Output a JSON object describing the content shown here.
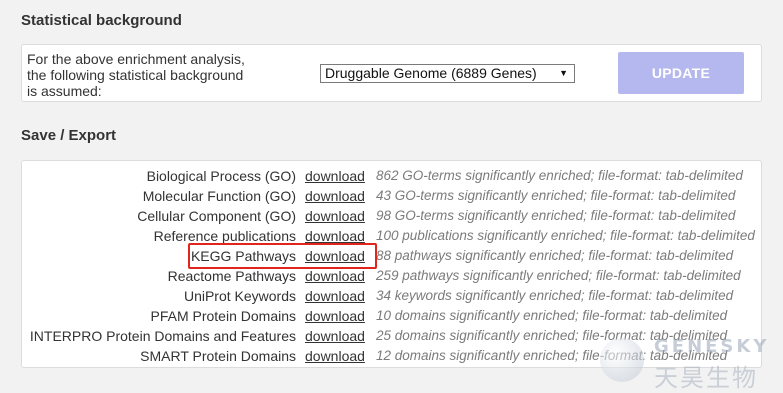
{
  "statistical_background": {
    "title": "Statistical background",
    "description_lines": [
      "For the above enrichment analysis,",
      "the following statistical background",
      "is assumed:"
    ],
    "select": {
      "selected": "Druggable Genome (6889 Genes)"
    },
    "update_label": "UPDATE"
  },
  "save_export": {
    "title": "Save / Export",
    "rows": [
      {
        "label": "Biological Process (GO)",
        "link": "download",
        "description": "862 GO-terms significantly enriched; file-format: tab-delimited"
      },
      {
        "label": "Molecular Function (GO)",
        "link": "download",
        "description": "43 GO-terms significantly enriched; file-format: tab-delimited"
      },
      {
        "label": "Cellular Component (GO)",
        "link": "download",
        "description": "98 GO-terms significantly enriched; file-format: tab-delimited"
      },
      {
        "label": "Reference publications",
        "link": "download",
        "description": "100 publications significantly enriched; file-format: tab-delimited"
      },
      {
        "label": "KEGG Pathways",
        "link": "download",
        "description": "88 pathways significantly enriched; file-format: tab-delimited"
      },
      {
        "label": "Reactome Pathways",
        "link": "download",
        "description": "259 pathways significantly enriched; file-format: tab-delimited"
      },
      {
        "label": "UniProt Keywords",
        "link": "download",
        "description": "34 keywords significantly enriched; file-format: tab-delimited"
      },
      {
        "label": "PFAM Protein Domains",
        "link": "download",
        "description": "10 domains significantly enriched; file-format: tab-delimited"
      },
      {
        "label": "INTERPRO Protein Domains and Features",
        "link": "download",
        "description": "25 domains significantly enriched; file-format: tab-delimited"
      },
      {
        "label": "SMART Protein Domains",
        "link": "download",
        "description": "12 domains significantly enriched; file-format: tab-delimited"
      }
    ]
  },
  "highlight": {
    "row_label": "KEGG Pathways",
    "color": "#e0261c"
  },
  "watermark": {
    "english": "GENESKY",
    "chinese": "天昊生物"
  },
  "colors": {
    "page_background": "#f2f2f2",
    "update_button": "#b5b8ee",
    "description_text": "#7b7b7b"
  },
  "icons": {
    "select_arrow": "dropdown-arrow-icon",
    "watermark_logo": "genesky-logo-icon"
  }
}
